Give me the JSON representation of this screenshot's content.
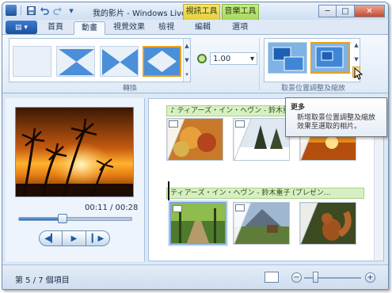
{
  "window": {
    "title": "我的影片 - Windows Live Mo...",
    "context_tabs": {
      "video_tools": "視訊工具",
      "music_tools": "音樂工具"
    },
    "controls": {
      "minimize": "─",
      "maximize": "□",
      "close": "✕"
    }
  },
  "quick_access": {
    "save_icon": "save-icon",
    "undo_icon": "undo-icon",
    "redo_icon": "redo-icon"
  },
  "tabs": [
    {
      "label": "首頁"
    },
    {
      "label": "動畫",
      "active": true
    },
    {
      "label": "視覺效果"
    },
    {
      "label": "檢視"
    },
    {
      "label": "編輯"
    },
    {
      "label": "選項"
    }
  ],
  "ribbon": {
    "transitions_label": "轉換",
    "pan_zoom_label": "取景位置調整及縮放",
    "duration_value": "1.00",
    "more_arrow": "▾"
  },
  "tooltip": {
    "title": "更多",
    "body": "新增取景位置調整及縮放效果至選取的相片。"
  },
  "preview": {
    "time": "00:11 / 00:28",
    "progress": 0.39,
    "prev_frame_icon": "previous-frame-icon",
    "play_icon": "play-icon",
    "next_frame_icon": "next-frame-icon"
  },
  "storyboard": {
    "music_track_1": "ティアーズ・イン・ヘヴン - 鈴木重",
    "music_track_2": "ティアーズ・イン・ヘヴン - 鈴木重子 (プレゼン..."
  },
  "status": {
    "item_text": "第 5 / 7 個項目",
    "zoom_level": 0.2
  },
  "colors": {
    "accent_blue": "#1c4f9c",
    "selection_orange": "#e8a21d",
    "music_green": "#d7f0c3"
  }
}
